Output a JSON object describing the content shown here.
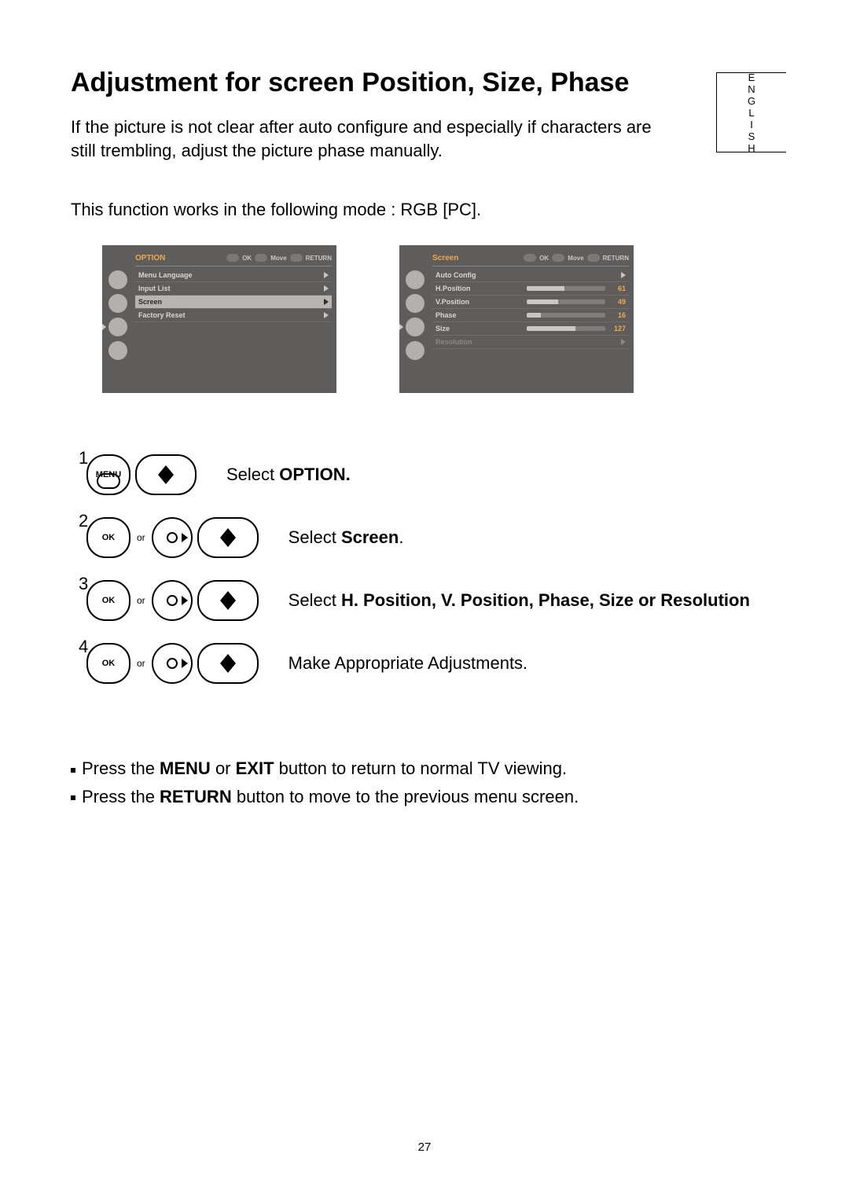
{
  "language_tab": "ENGLISH",
  "title": "Adjustment for screen Position, Size, Phase",
  "intro": "If the picture is not clear after auto configure and especially if characters are still trembling, adjust the picture phase manually.",
  "mode_line": "This function works in the following mode : RGB [PC].",
  "osd1": {
    "title": "OPTION",
    "hints": {
      "ok": "OK",
      "move": "Move",
      "return": "RETURN"
    },
    "rows": [
      {
        "label": "Menu Language",
        "type": "nav"
      },
      {
        "label": "Input List",
        "type": "nav"
      },
      {
        "label": "Screen",
        "type": "nav",
        "highlight": true
      },
      {
        "label": "Factory Reset",
        "type": "nav"
      }
    ]
  },
  "osd2": {
    "title": "Screen",
    "hints": {
      "ok": "OK",
      "move": "Move",
      "return": "RETURN"
    },
    "rows": [
      {
        "label": "Auto Config",
        "type": "nav"
      },
      {
        "label": "H.Position",
        "type": "slider",
        "value": 61,
        "pct": 48
      },
      {
        "label": "V.Position",
        "type": "slider",
        "value": 49,
        "pct": 40
      },
      {
        "label": "Phase",
        "type": "slider",
        "value": 16,
        "pct": 18
      },
      {
        "label": "Size",
        "type": "slider",
        "value": 127,
        "pct": 62
      },
      {
        "label": "Resolution",
        "type": "nav",
        "disabled": true
      }
    ]
  },
  "steps": {
    "s1": {
      "num": "1",
      "btn": "MENU",
      "prefix": "Select ",
      "bold": "OPTION."
    },
    "s2": {
      "num": "2",
      "btn": "OK",
      "prefix": "Select ",
      "bold": "Screen",
      "suffix": "."
    },
    "s3": {
      "num": "3",
      "btn": "OK",
      "prefix": "Select ",
      "bold": "H. Position, V. Position, Phase, Size or Resolution"
    },
    "s4": {
      "num": "4",
      "btn": "OK",
      "text": "Make Appropriate Adjustments."
    }
  },
  "or_label": "or",
  "footer": {
    "line1_a": "Press the ",
    "line1_b": "MENU",
    "line1_c": " or ",
    "line1_d": "EXIT",
    "line1_e": " button to return to normal TV viewing.",
    "line2_a": "Press the ",
    "line2_b": "RETURN",
    "line2_c": " button to move to the previous menu screen."
  },
  "page_number": "27"
}
